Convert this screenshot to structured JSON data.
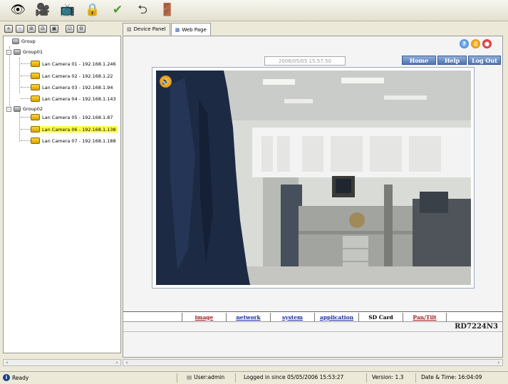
{
  "toolbar": {
    "icons": [
      "view-icon",
      "record-icon",
      "monitor-icon",
      "lock-icon",
      "snapshot-icon",
      "connect-icon",
      "exit-icon"
    ]
  },
  "tabs": [
    {
      "label": "Device Panel",
      "active": false
    },
    {
      "label": "Web Page",
      "active": true
    }
  ],
  "tree": {
    "root": "Group",
    "groups": [
      {
        "label": "Group01",
        "cameras": [
          "Lan Camera 01 - 192.168.1.246",
          "Lan Camera 02 - 192.168.1.22",
          "Lan Camera 03 - 192.168.1.94",
          "Lan Camera 04 - 192.168.1.143"
        ]
      },
      {
        "label": "Group02",
        "cameras": [
          "Lan Camera 05 - 192.168.1.87",
          "Lan Camera 06 - 192.168.1.138",
          "Lan Camera 07 - 192.168.1.188"
        ]
      }
    ],
    "selected": "Lan Camera 06 - 192.168.1.138"
  },
  "web": {
    "datetime": "2006/05/05 15:57:50",
    "nav": [
      "Home",
      "Help",
      "Log Out"
    ],
    "menu": [
      {
        "label": "image",
        "color": "#9a1a1a"
      },
      {
        "label": "network",
        "color": "#1a2a9a"
      },
      {
        "label": "system",
        "color": "#1a2a9a"
      },
      {
        "label": "application",
        "color": "#1a2a9a"
      },
      {
        "label": "SD Card",
        "color": "#000000"
      },
      {
        "label": "Pan/Tilt",
        "color": "#9a1a1a"
      }
    ],
    "model": "RD7224N3"
  },
  "status": {
    "ready": "Ready",
    "user": "User:admin",
    "logged": "Logged in since 05/05/2006 15:53:27",
    "version": "Version: 1.3",
    "datetime": "Date & Time:  16:04:09"
  }
}
